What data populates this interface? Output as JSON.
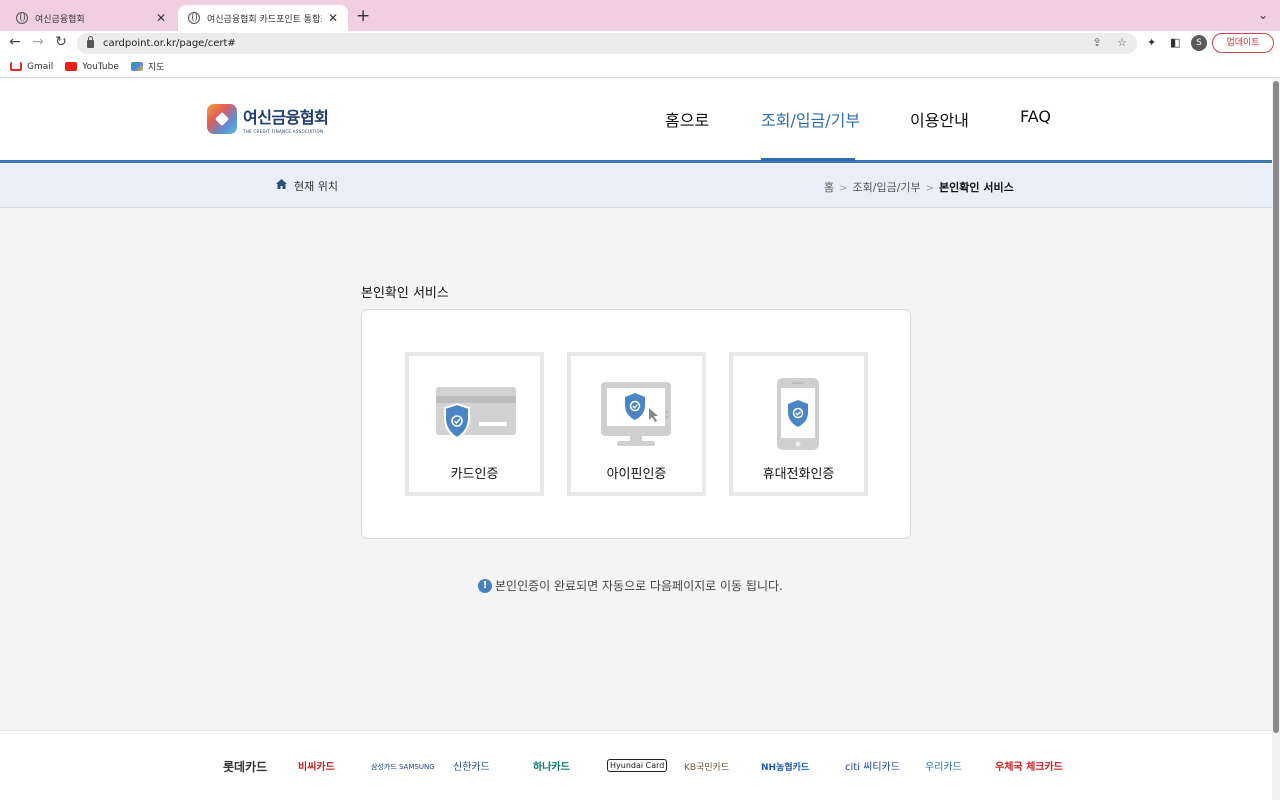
{
  "browser": {
    "tabs": [
      {
        "title": "여신금융협회"
      },
      {
        "title": "여신금융협회 카드포인트 통합조회 ..."
      }
    ],
    "url": "cardpoint.or.kr/page/cert#",
    "profile_initial": "S",
    "update_label": "업데이트",
    "bookmarks": [
      {
        "label": "Gmail",
        "icon": "gmail-icon"
      },
      {
        "label": "YouTube",
        "icon": "youtube-icon"
      },
      {
        "label": "지도",
        "icon": "maps-icon"
      }
    ]
  },
  "header": {
    "logo_ko": "여신금융협회",
    "logo_en": "THE CREDIT FINANCE ASSOCIATION",
    "nav": [
      {
        "label": "홈으로"
      },
      {
        "label": "조회/입금/기부",
        "active": true
      },
      {
        "label": "이용안내"
      },
      {
        "label": "FAQ"
      }
    ],
    "accent_color": "#2d6db0"
  },
  "breadcrumb": {
    "label": "현재 위치",
    "items": [
      "홈",
      "조회/입금/기부",
      "본인확인 서비스"
    ]
  },
  "main": {
    "title": "본인확인 서비스",
    "options": [
      {
        "label": "카드인증",
        "icon": "credit-card-shield-icon"
      },
      {
        "label": "아이핀인증",
        "icon": "monitor-shield-icon"
      },
      {
        "label": "휴대전화인증",
        "icon": "phone-shield-icon"
      }
    ],
    "notice": "본인인증이 완료되면 자동으로 다음페이지로 이동 됩니다."
  },
  "footer": {
    "partners": [
      "롯데카드",
      "비씨카드",
      "삼성카드 SAMSUNG",
      "신한카드",
      "하나카드",
      "Hyundai Card",
      "KB국민카드",
      "NH농협카드",
      "citi 씨티카드",
      "우리카드",
      "우체국 체크카드"
    ]
  }
}
